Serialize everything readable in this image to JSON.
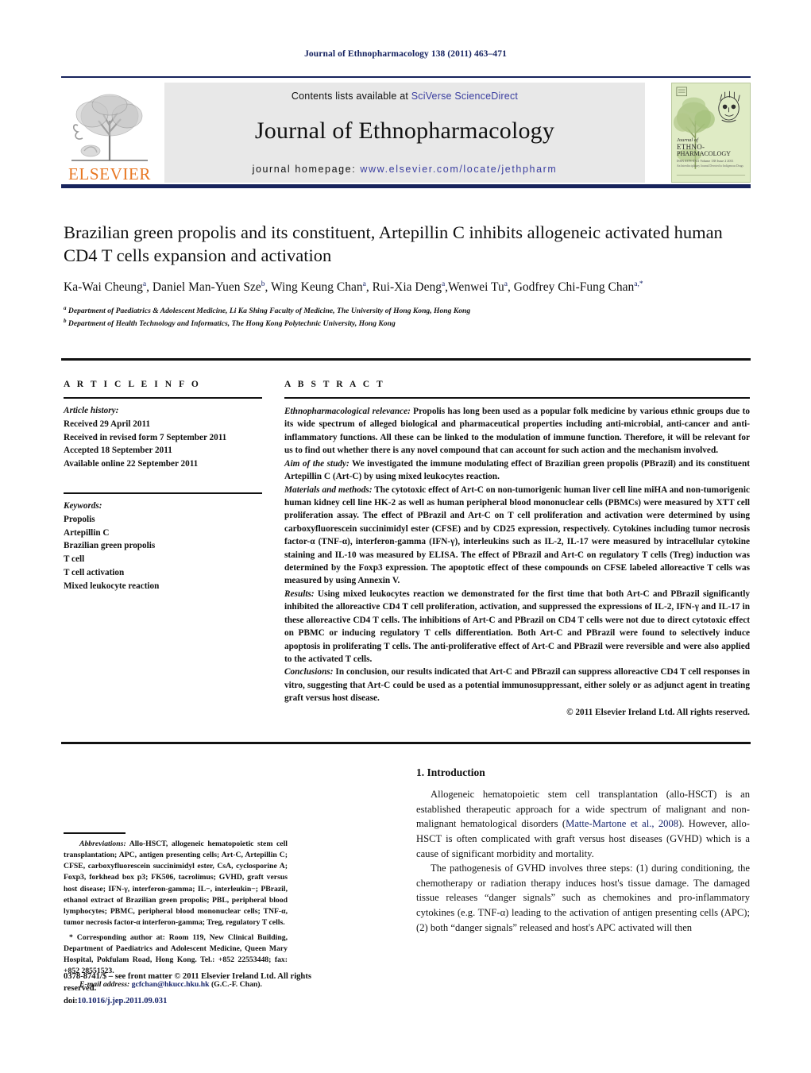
{
  "running_head": "Journal of Ethnopharmacology 138 (2011) 463–471",
  "masthead": {
    "contents_prefix": "Contents lists available at ",
    "contents_link": "SciVerse ScienceDirect",
    "journal_title": "Journal of Ethnopharmacology",
    "homepage_prefix": "journal homepage: ",
    "homepage_url": "www.elsevier.com/locate/jethpharm",
    "publisher_logo_text": "ELSEVIER",
    "cover": {
      "line1": "Journal of",
      "line2": "ETHNO-",
      "line3": "PHARMACOLOGY",
      "line4": "ISSN 0378-8741  Volume 138  Issue 2  2011",
      "line5": "An Interdisciplinary Journal Devoted to Indigenous Drugs"
    }
  },
  "article": {
    "title": "Brazilian green propolis and its constituent, Artepillin C inhibits allogeneic activated human CD4 T cells expansion and activation",
    "authors": [
      {
        "name": "Ka-Wai Cheung",
        "sup": "a",
        "sep": ", "
      },
      {
        "name": "Daniel Man-Yuen Sze",
        "sup": "b",
        "sep": ", "
      },
      {
        "name": "Wing Keung Chan",
        "sup": "a",
        "sep": ", "
      },
      {
        "name": "Rui-Xia Deng",
        "sup": "a",
        "sep": ","
      },
      {
        "name": "Wenwei Tu",
        "sup": "a",
        "sep": ", "
      },
      {
        "name": "Godfrey Chi-Fung Chan",
        "sup": "a,*",
        "sep": ""
      }
    ],
    "affiliations": [
      {
        "sup": "a",
        "text": "Department of Paediatrics & Adolescent Medicine, Li Ka Shing Faculty of Medicine, The University of Hong Kong, Hong Kong"
      },
      {
        "sup": "b",
        "text": "Department of Health Technology and Informatics, The Hong Kong Polytechnic University, Hong Kong"
      }
    ]
  },
  "info": {
    "heading": "A R T I C L E  I N F O",
    "history_label": "Article history:",
    "history": [
      "Received 29 April 2011",
      "Received in revised form 7 September 2011",
      "Accepted 18 September 2011",
      "Available online 22 September 2011"
    ],
    "keywords_label": "Keywords:",
    "keywords": [
      "Propolis",
      "Artepillin C",
      "Brazilian green propolis",
      "T cell",
      "T cell activation",
      "Mixed leukocyte reaction"
    ]
  },
  "abstract": {
    "heading": "A B S T R A C T",
    "paragraphs": [
      {
        "label": "Ethnopharmacological relevance:",
        "text": " Propolis has long been used as a popular folk medicine by various ethnic groups due to its wide spectrum of alleged biological and pharmaceutical properties including anti-microbial, anti-cancer and anti-inflammatory functions. All these can be linked to the modulation of immune function. Therefore, it will be relevant for us to find out whether there is any novel compound that can account for such action and the mechanism involved."
      },
      {
        "label": "Aim of the study:",
        "text": " We investigated the immune modulating effect of Brazilian green propolis (PBrazil) and its constituent Artepillin C (Art-C) by using mixed leukocytes reaction."
      },
      {
        "label": "Materials and methods:",
        "text": " The cytotoxic effect of Art-C on non-tumorigenic human liver cell line miHA and non-tumorigenic human kidney cell line HK-2 as well as human peripheral blood mononuclear cells (PBMCs) were measured by XTT cell proliferation assay. The effect of PBrazil and Art-C on T cell proliferation and activation were determined by using carboxyfluorescein succinimidyl ester (CFSE) and by CD25 expression, respectively. Cytokines including tumor necrosis factor-α (TNF-α), interferon-gamma (IFN-γ), interleukins such as IL-2, IL-17 were measured by intracellular cytokine staining and IL-10 was measured by ELISA. The effect of PBrazil and Art-C on regulatory T cells (Treg) induction was determined by the Foxp3 expression. The apoptotic effect of these compounds on CFSE labeled alloreactive T cells was measured by using Annexin V."
      },
      {
        "label": "Results:",
        "text": " Using mixed leukocytes reaction we demonstrated for the first time that both Art-C and PBrazil significantly inhibited the alloreactive CD4 T cell proliferation, activation, and suppressed the expressions of IL-2, IFN-γ and IL-17 in these alloreactive CD4 T cells. The inhibitions of Art-C and PBrazil on CD4 T cells were not due to direct cytotoxic effect on PBMC or inducing regulatory T cells differentiation. Both Art-C and PBrazil were found to selectively induce apoptosis in proliferating T cells. The anti-proliferative effect of Art-C and PBrazil were reversible and were also applied to the activated T cells."
      },
      {
        "label": "Conclusions:",
        "text": " In conclusion, our results indicated that Art-C and PBrazil can suppress alloreactive CD4 T cell responses in vitro, suggesting that Art-C could be used as a potential immunosuppressant, either solely or as adjunct agent in treating graft versus host disease."
      }
    ],
    "copyright": "© 2011 Elsevier Ireland Ltd. All rights reserved."
  },
  "introduction": {
    "heading": "1. Introduction",
    "para1_a": "Allogeneic hematopoietic stem cell transplantation (allo-HSCT) is an established therapeutic approach for a wide spectrum of malignant and non-malignant hematological disorders (",
    "para1_cite": "Matte-Martone et al., 2008",
    "para1_b": "). However, allo-HSCT is often complicated with graft versus host diseases (GVHD) which is a cause of significant morbidity and mortality.",
    "para2": "The pathogenesis of GVHD involves three steps: (1) during conditioning, the chemotherapy or radiation therapy induces host's tissue damage. The damaged tissue releases “danger signals” such as chemokines and pro-inflammatory cytokines (e.g. TNF-α) leading to the activation of antigen presenting cells (APC); (2) both “danger signals” released and host's APC activated will then"
  },
  "footnotes": {
    "abbrev_label": "Abbreviations:",
    "abbrev_text": " Allo-HSCT, allogeneic hematopoietic stem cell transplantation; APC, antigen presenting cells; Art-C, Artepillin C; CFSE, carboxyfluorescein succinimidyl ester, CsA, cyclosporine A; Foxp3, forkhead box p3; FK506, tacrolimus; GVHD, graft versus host disease; IFN-γ, interferon-gamma; IL−, interleukin−; PBrazil, ethanol extract of Brazilian green propolis; PBL, peripheral blood lymphocytes; PBMC, peripheral blood mononuclear cells; TNF-α, tumor necrosis factor-α interferon-gamma; Treg, regulatory T cells.",
    "corresponding": "* Corresponding author at: Room 119, New Clinical Building, Department of Paediatrics and Adolescent Medicine, Queen Mary Hospital, Pokfulam Road, Hong Kong. Tel.: +852 22553448; fax: +852 28551523.",
    "email_label": "E-mail address:",
    "email": "gcfchan@hkucc.hku.hk",
    "email_suffix": " (G.C.-F. Chan).",
    "issn_line": "0378-8741/$ – see front matter © 2011 Elsevier Ireland Ltd. All rights reserved.",
    "doi_prefix": "doi:",
    "doi": "10.1016/j.jep.2011.09.031"
  }
}
